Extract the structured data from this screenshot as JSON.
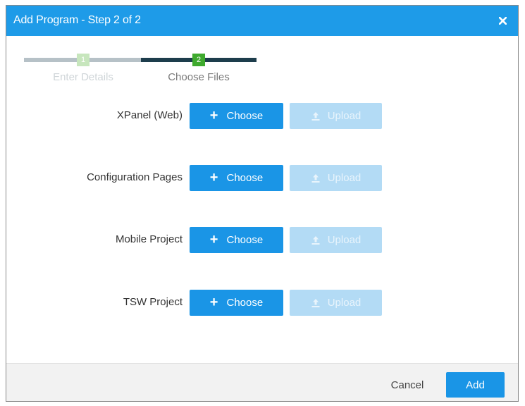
{
  "dialog": {
    "title": "Add Program - Step 2 of 2",
    "close_icon": "close-icon",
    "colors": {
      "header": "#1e9be8",
      "primary_button": "#1a95e6",
      "disabled_button": "#b3dbf5",
      "step_active": "#3faa2e",
      "step_done": "#c7e6bd"
    }
  },
  "stepper": {
    "steps": [
      {
        "number": "1",
        "label": "Enter Details",
        "state": "completed"
      },
      {
        "number": "2",
        "label": "Choose Files",
        "state": "active"
      }
    ]
  },
  "file_rows": [
    {
      "label": "XPanel (Web)",
      "choose": "Choose",
      "upload": "Upload"
    },
    {
      "label": "Configuration Pages",
      "choose": "Choose",
      "upload": "Upload"
    },
    {
      "label": "Mobile Project",
      "choose": "Choose",
      "upload": "Upload"
    },
    {
      "label": "TSW Project",
      "choose": "Choose",
      "upload": "Upload"
    }
  ],
  "icons": {
    "choose": "plus-icon",
    "upload": "upload-icon"
  },
  "footer": {
    "cancel_label": "Cancel",
    "add_label": "Add"
  }
}
